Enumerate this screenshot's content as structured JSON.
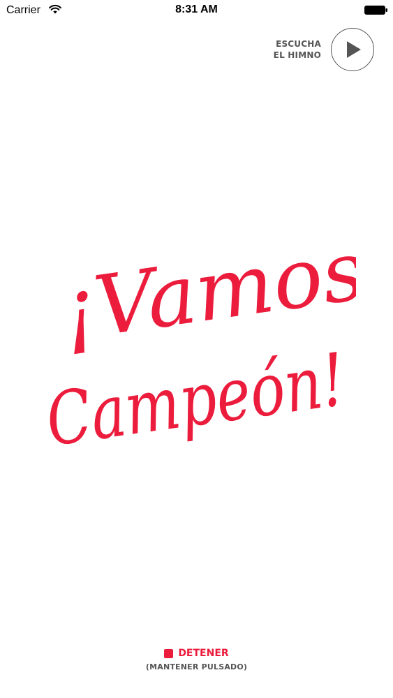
{
  "status_bar": {
    "carrier": "Carrier",
    "time": "8:31 AM",
    "wifi_icon": "wifi-icon",
    "battery_icon": "battery-icon"
  },
  "anthem": {
    "label_line1": "ESCUCHA",
    "label_line2": "EL HIMNO",
    "button_icon": "play-icon"
  },
  "slogan": {
    "line1": "¡Vamos",
    "line2": "Campeón!"
  },
  "stop": {
    "label": "DETENER",
    "hint": "(MANTENER PULSADO)",
    "icon": "stop-icon"
  },
  "colors": {
    "accent": "#ec1c3c",
    "secondary_text": "#555555",
    "background": "#ffffff"
  }
}
